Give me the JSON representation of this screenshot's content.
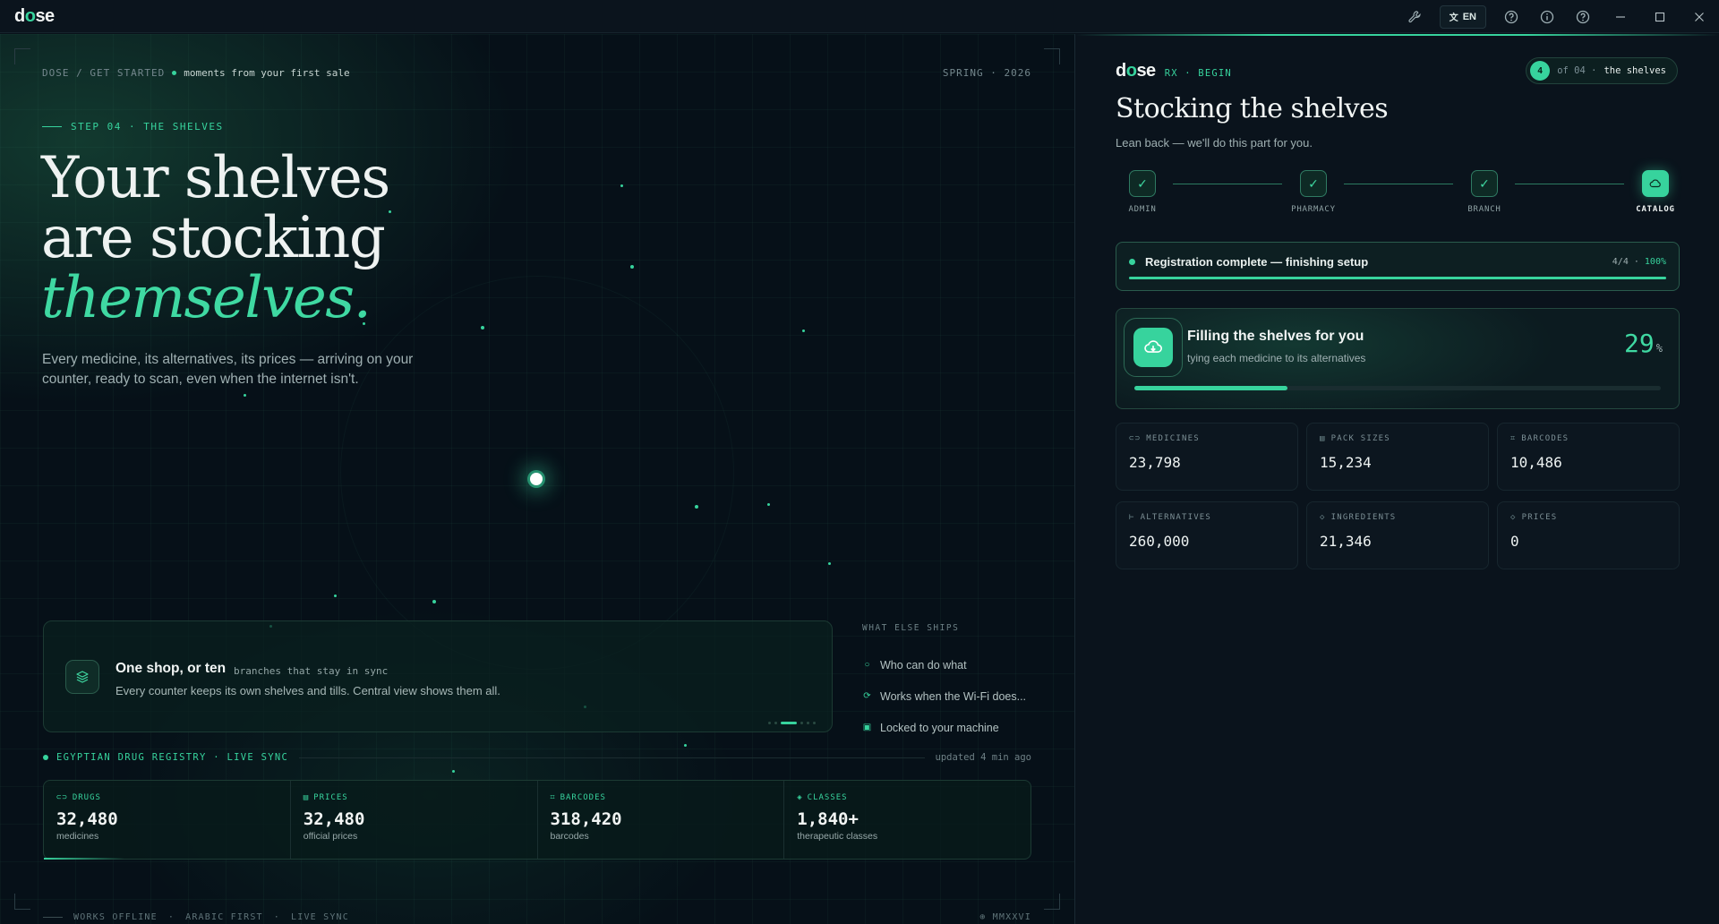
{
  "titlebar": {
    "brand_prefix": "d",
    "brand_o": "o",
    "brand_suffix": "se",
    "language": "EN",
    "icons": [
      "wrench-icon",
      "translate-icon",
      "help-circle-icon",
      "info-icon",
      "help-circle-icon"
    ],
    "window_controls": [
      "minimize",
      "maximize",
      "close"
    ]
  },
  "left": {
    "breadcrumb": "DOSE / GET STARTED",
    "breadcrumb_hint": "moments from your first sale",
    "season": "SPRING · 2026",
    "step_label": "STEP 04 · THE SHELVES",
    "hero_line1": "Your shelves",
    "hero_line2": "are stocking",
    "hero_accent": "themselves.",
    "hero_sub": "Every medicine, its alternatives, its prices — arriving on your counter, ready to scan, even when the internet isn't.",
    "feature": {
      "title": "One shop, or ten",
      "tag": "branches that stay in sync",
      "desc": "Every counter keeps its own shelves and tills. Central view shows them all."
    },
    "also": {
      "title": "WHAT ELSE SHIPS",
      "items": [
        "Who can do what",
        "Works when the Wi-Fi does...",
        "Locked to your machine"
      ]
    },
    "registry": {
      "title": "EGYPTIAN DRUG REGISTRY · LIVE SYNC",
      "updated": "updated 4 min ago",
      "cells": [
        {
          "label": "DRUGS",
          "value": "32,480",
          "sub": "medicines"
        },
        {
          "label": "PRICES",
          "value": "32,480",
          "sub": "official prices"
        },
        {
          "label": "BARCODES",
          "value": "318,420",
          "sub": "barcodes"
        },
        {
          "label": "CLASSES",
          "value": "1,840+",
          "sub": "therapeutic classes"
        }
      ]
    },
    "footer": {
      "tags": [
        "WORKS OFFLINE",
        "ARABIC FIRST",
        "LIVE SYNC"
      ],
      "year": "MMXXVI"
    }
  },
  "right": {
    "tag": "RX · BEGIN",
    "step_num": "4",
    "step_of": "of 04 ·",
    "step_name": "the shelves",
    "title": "Stocking the shelves",
    "subtitle": "Lean back — we'll do this part for you.",
    "steps": [
      {
        "label": "ADMIN",
        "state": "done"
      },
      {
        "label": "PHARMACY",
        "state": "done"
      },
      {
        "label": "BRANCH",
        "state": "done"
      },
      {
        "label": "CATALOG",
        "state": "active"
      }
    ],
    "registration": {
      "text": "Registration complete — finishing setup",
      "count": "4/4",
      "percent": "100%",
      "progress": 1.0
    },
    "filling": {
      "title": "Filling the shelves for you",
      "sub": "tying each medicine to its alternatives",
      "percent": "29",
      "unit": "%",
      "progress": 0.29
    },
    "stats": [
      {
        "label": "MEDICINES",
        "value": "23,798",
        "icon": "pill-icon"
      },
      {
        "label": "PACK SIZES",
        "value": "15,234",
        "icon": "box-icon"
      },
      {
        "label": "BARCODES",
        "value": "10,486",
        "icon": "barcode-icon"
      },
      {
        "label": "ALTERNATIVES",
        "value": "260,000",
        "icon": "branch-icon"
      },
      {
        "label": "INGREDIENTS",
        "value": "21,346",
        "icon": "diamond-icon"
      },
      {
        "label": "PRICES",
        "value": "0",
        "icon": "tag-icon"
      }
    ]
  },
  "colors": {
    "accent": "#37d39d",
    "background": "#081119",
    "panel": "#0a131c"
  }
}
